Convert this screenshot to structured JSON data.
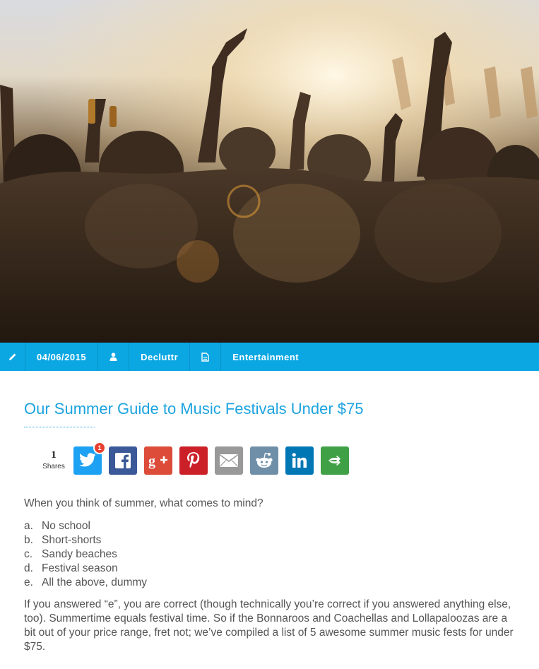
{
  "hero": {
    "image_icon": "festival-crowd-photo"
  },
  "meta": {
    "edit_icon": "pencil-icon",
    "date": "04/06/2015",
    "author_icon": "user-icon",
    "author": "Decluttr",
    "category_icon": "document-icon",
    "category": "Entertainment",
    "bar_color": "#0ba7e3"
  },
  "article": {
    "title": "Our Summer Guide to Music Festivals Under $75",
    "intro": "When you think of summer, what comes to mind?",
    "list": [
      {
        "marker": "a.",
        "text": "No school"
      },
      {
        "marker": "b.",
        "text": "Short-shorts"
      },
      {
        "marker": "c.",
        "text": "Sandy beaches"
      },
      {
        "marker": "d.",
        "text": "Festival season"
      },
      {
        "marker": "e.",
        "text": "All the above, dummy"
      }
    ],
    "paragraph": "If you answered “e”, you are correct (though technically you’re correct if you answered anything else, too).  Summertime equals festival time. So if the Bonnaroos and Coachellas and Lollapaloozas are a bit out of your price range, fret not; we’ve compiled a list of 5 awesome summer music fests for under $75."
  },
  "share": {
    "count": "1",
    "label": "Shares",
    "twitter_badge": "1",
    "buttons": [
      {
        "name": "twitter",
        "icon": "twitter-icon",
        "color": "#1da1f2"
      },
      {
        "name": "facebook",
        "icon": "facebook-icon",
        "color": "#3b5998"
      },
      {
        "name": "google-plus",
        "icon": "google-plus-icon",
        "color": "#dd4b39"
      },
      {
        "name": "pinterest",
        "icon": "pinterest-icon",
        "color": "#cb2027"
      },
      {
        "name": "email",
        "icon": "email-icon",
        "color": "#999999"
      },
      {
        "name": "reddit",
        "icon": "reddit-icon",
        "color": "#6f8fa8"
      },
      {
        "name": "linkedin",
        "icon": "linkedin-icon",
        "color": "#0077b5"
      },
      {
        "name": "more",
        "icon": "more-icon",
        "color": "#3fa046"
      }
    ]
  }
}
